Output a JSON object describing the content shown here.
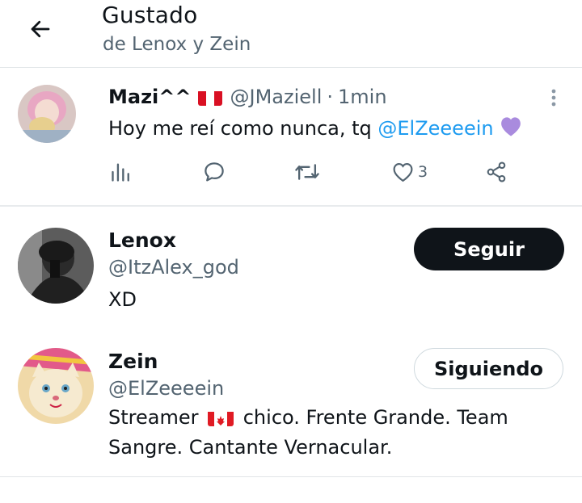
{
  "header": {
    "title": "Gustado",
    "subtitle": "de Lenox y Zein"
  },
  "tweet": {
    "author_name": "Mazi^^",
    "handle": "@JMaziell",
    "separator": "·",
    "time": "1min",
    "text_before": "Hoy me reí como nunca, tq ",
    "mention": "@ElZeeeein",
    "emoji_icon": "purple-heart",
    "like_count": "3"
  },
  "users": [
    {
      "name": "Lenox",
      "handle": "@ItzAlex_god",
      "bio": "XD",
      "button_label": "Seguir"
    },
    {
      "name": "Zein",
      "handle": "@ElZeeeein",
      "bio_before": "Streamer ",
      "bio_after": " chico. Frente Grande. Team Sangre. Cantante Vernacular.",
      "button_label": "Siguiendo"
    }
  ],
  "colors": {
    "accent": "#1d9bf0",
    "text": "#0f1419",
    "muted": "#536471",
    "follow_bg": "#0f1419"
  }
}
